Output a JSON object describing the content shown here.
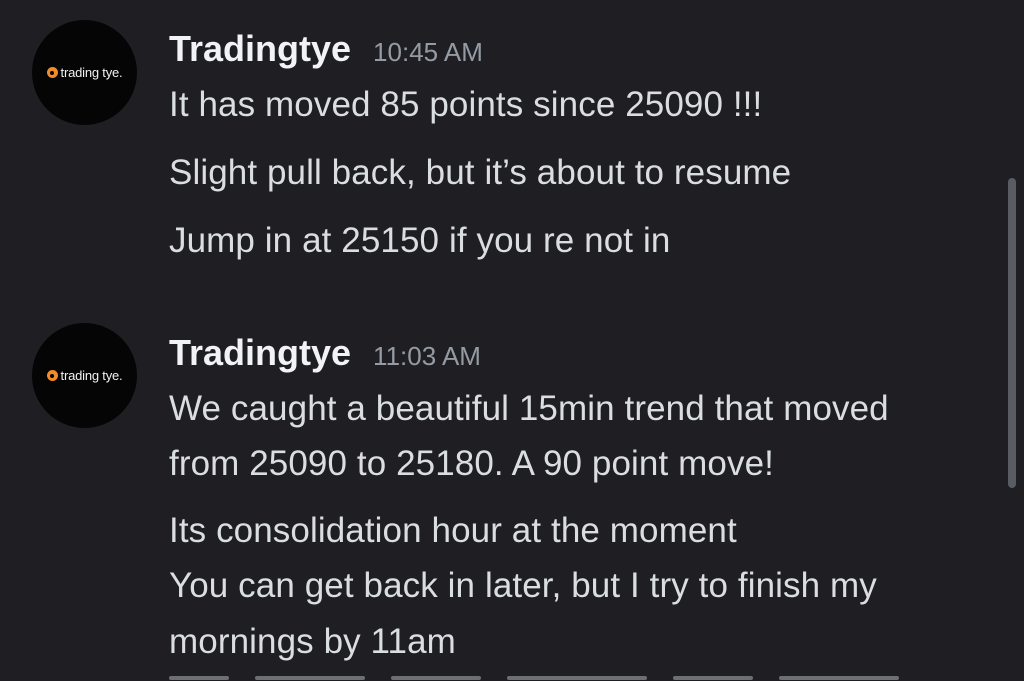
{
  "messages": [
    {
      "avatar": {
        "logo_text": "trading tye.",
        "logo_icon": "orange-circle-logo-icon",
        "accent": "#f28c28"
      },
      "author": "Tradingtye",
      "time": "10:45 AM",
      "lines": [
        "It has moved 85 points since 25090 !!!",
        "Slight pull back, but it’s about to resume",
        "Jump in at 25150 if you re not in"
      ]
    },
    {
      "avatar": {
        "logo_text": "trading tye.",
        "logo_icon": "orange-circle-logo-icon",
        "accent": "#f28c28"
      },
      "author": "Tradingtye",
      "time": "11:03 AM",
      "lines": [
        "We caught a beautiful 15min trend that moved",
        "from 25090 to 25180. A 90 point move!",
        "Its consolidation hour at the moment",
        "You can get back in later, but I try to finish my",
        "mornings by 11am"
      ]
    }
  ],
  "theme": {
    "background": "#1f1f23",
    "text": "#dbdee1",
    "username": "#f2f3f5",
    "timestamp": "#949ba4",
    "scrollbar": "#5a5c63"
  }
}
